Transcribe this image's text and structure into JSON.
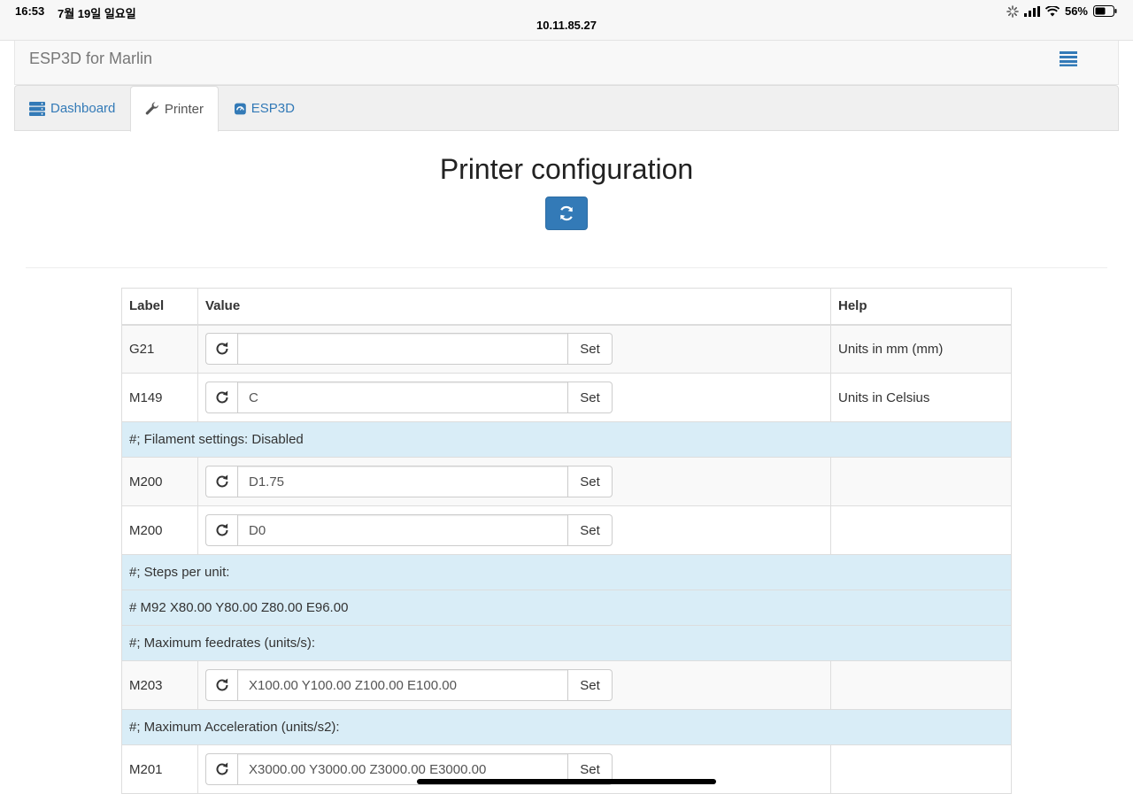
{
  "status_bar": {
    "time": "16:53",
    "date": "7월 19일 일요일",
    "url": "10.11.85.27",
    "battery": "56%"
  },
  "navbar": {
    "brand": "ESP3D for Marlin",
    "menu_icon": "hamburger-menu-icon"
  },
  "tabs": [
    {
      "label": "Dashboard",
      "icon": "server-icon",
      "active": false
    },
    {
      "label": "Printer",
      "icon": "wrench-icon",
      "active": true
    },
    {
      "label": "ESP3D",
      "icon": "esp3d-icon",
      "active": false
    }
  ],
  "page": {
    "title": "Printer configuration"
  },
  "table": {
    "headers": {
      "label": "Label",
      "value": "Value",
      "help": "Help"
    },
    "set_label": "Set",
    "rows": [
      {
        "label": "G21",
        "value": "",
        "help": "Units in mm (mm)"
      },
      {
        "label": "M149",
        "value": "C",
        "help": "Units in Celsius"
      },
      {
        "section": "#; Filament settings: Disabled"
      },
      {
        "label": "M200",
        "value": "D1.75",
        "help": ""
      },
      {
        "label": "M200",
        "value": "D0",
        "help": ""
      },
      {
        "section": "#; Steps per unit:"
      },
      {
        "section": "# M92 X80.00 Y80.00 Z80.00 E96.00"
      },
      {
        "section": "#; Maximum feedrates (units/s):"
      },
      {
        "label": "M203",
        "value": "X100.00 Y100.00 Z100.00 E100.00",
        "help": ""
      },
      {
        "section": "#; Maximum Acceleration (units/s2):"
      },
      {
        "label": "M201",
        "value": "X3000.00 Y3000.00 Z3000.00 E3000.00",
        "help": ""
      }
    ]
  },
  "colors": {
    "primary": "#337ab7",
    "section_bg": "#d9edf7",
    "navbar_bg": "#f8f8f8"
  }
}
